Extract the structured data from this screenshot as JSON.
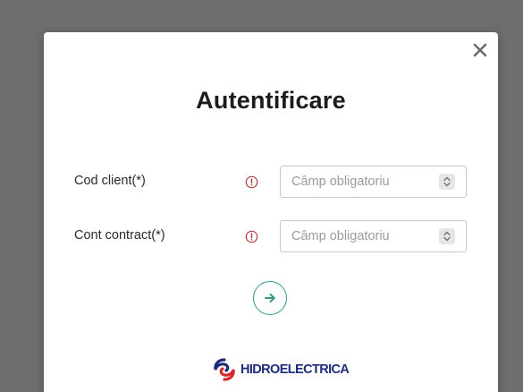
{
  "modal": {
    "title": "Autentificare",
    "close_icon": "close-icon",
    "fields": [
      {
        "label": "Cod client(*)",
        "placeholder": "Câmp obligatoriu",
        "value": "",
        "info_icon": "info-circle-icon"
      },
      {
        "label": "Cont contract(*)",
        "placeholder": "Câmp obligatoriu",
        "value": "",
        "info_icon": "info-circle-icon"
      }
    ],
    "submit_icon": "arrow-right-icon",
    "logo_text": "HIDROELECTRICA"
  },
  "colors": {
    "overlay": "#6e6e6e",
    "accent": "#2e9a85",
    "info": "#b33a3a",
    "brand_blue": "#1d2c7a",
    "brand_red": "#d52b2b"
  }
}
